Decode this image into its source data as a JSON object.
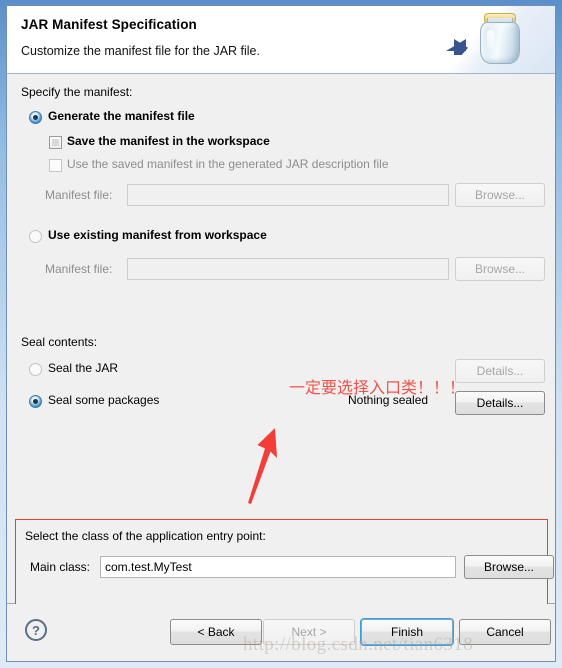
{
  "header": {
    "title": "JAR Manifest Specification",
    "description": "Customize the manifest file for the JAR file.",
    "icon": "jar-icon"
  },
  "manifest_section": {
    "label": "Specify the manifest:",
    "radio_generate": "Generate the manifest file",
    "check_save_workspace": "Save the manifest in the workspace",
    "check_use_saved": "Use the saved manifest in the generated JAR description file",
    "manifest_file_label_1": "Manifest file:",
    "manifest_file_value_1": "",
    "browse_1": "Browse...",
    "radio_use_existing": "Use existing manifest from workspace",
    "manifest_file_label_2": "Manifest file:",
    "manifest_file_value_2": "",
    "browse_2": "Browse..."
  },
  "seal_section": {
    "label": "Seal contents:",
    "radio_seal_jar": "Seal the JAR",
    "details_jar": "Details...",
    "radio_seal_packages": "Seal some packages",
    "sealed_status": "Nothing sealed",
    "details_packages": "Details..."
  },
  "entry_point": {
    "label": "Select the class of the application entry point:",
    "main_class_label": "Main class:",
    "main_class_value": "com.test.MyTest",
    "browse": "Browse...",
    "border_color": "#e8413a"
  },
  "annotation": {
    "text": "一定要选择入口类！！！",
    "color": "#f0534c",
    "arrow": "red-arrow-up-right"
  },
  "footer": {
    "help": "?",
    "back": "< Back",
    "next": "Next >",
    "finish": "Finish",
    "cancel": "Cancel"
  },
  "watermark": {
    "text": "http://blog.csdn.net/tian6318"
  }
}
